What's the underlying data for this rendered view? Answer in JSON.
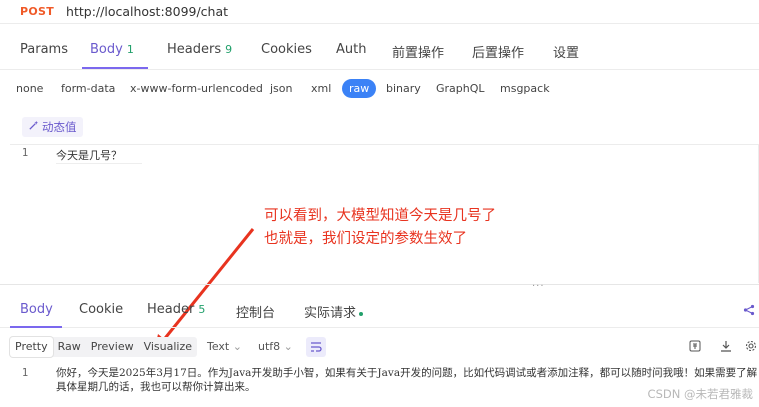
{
  "request": {
    "method": "POST",
    "url": "http://localhost:8099/chat"
  },
  "request_tabs": [
    {
      "label": "Params"
    },
    {
      "label": "Body",
      "count": "1"
    },
    {
      "label": "Headers",
      "count": "9"
    },
    {
      "label": "Cookies"
    },
    {
      "label": "Auth"
    },
    {
      "label": "前置操作"
    },
    {
      "label": "后置操作"
    },
    {
      "label": "设置"
    }
  ],
  "body_types": [
    "none",
    "form-data",
    "x-www-form-urlencoded",
    "json",
    "xml",
    "raw",
    "binary",
    "GraphQL",
    "msgpack"
  ],
  "selected_body_type": "raw",
  "dynamic_value_label": "动态值",
  "editor": {
    "line_number": "1",
    "content": "今天是几号？"
  },
  "annotation": {
    "line1": "可以看到，大模型知道今天是几号了",
    "line2": "也就是，我们设定的参数生效了"
  },
  "splitter_handle": "···",
  "response_tabs": [
    {
      "label": "Body"
    },
    {
      "label": "Cookie"
    },
    {
      "label": "Header",
      "count": "5"
    },
    {
      "label": "控制台"
    },
    {
      "label": "实际请求"
    }
  ],
  "view_modes": [
    "Pretty",
    "Raw",
    "Preview",
    "Visualize"
  ],
  "selected_view_mode": "Pretty",
  "format_dropdown": "Text",
  "encoding_dropdown": "utf8",
  "response": {
    "line_number": "1",
    "content": "你好，今天是2025年3月17日。作为Java开发助手小智，如果有关于Java开发的问题，比如代码调试或者添加注释，都可以随时问我哦！如果需要了解具体星期几的话，我也可以帮你计算出来。"
  },
  "watermark": "CSDN @未若君雅裁",
  "colors": {
    "accent": "#7b68ee",
    "method": "#f05a28",
    "count": "#22a06b",
    "raw_pill": "#3b82f6",
    "annotation": "#e8331f"
  }
}
